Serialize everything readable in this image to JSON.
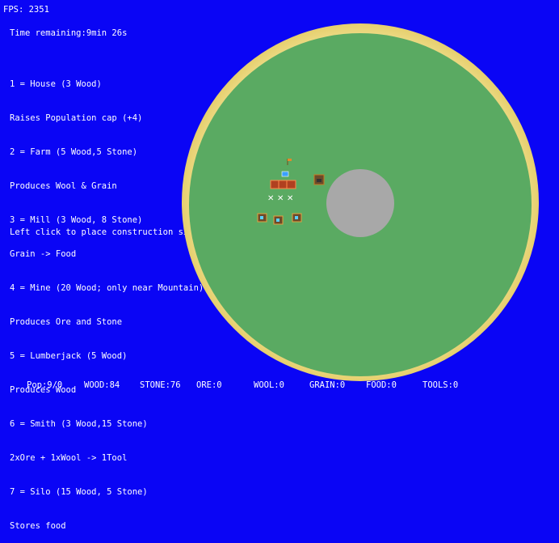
{
  "hud": {
    "fps": "FPS: 2351",
    "time_remaining": "Time remaining:9min 26s"
  },
  "build_menu": [
    "1 = House (3 Wood)",
    "Raises Population cap (+4)",
    "2 = Farm (5 Wood,5 Stone)",
    "Produces Wool & Grain",
    "3 = Mill (3 Wood, 8 Stone)",
    "Grain -> Food",
    "4 = Mine (20 Wood; only near Mountain)",
    "Produces Ore and Stone",
    "5 = Lumberjack (5 Wood)",
    "Produces Wood",
    "6 = Smith (3 Wood,15 Stone)",
    "2xOre + 1xWool -> 1Tool",
    "7 = Silo (15 Wood, 5 Stone)",
    "Stores food"
  ],
  "hint": "Left click to place construction site.",
  "resources": {
    "pop": "Pop:9/0",
    "wood": "WOOD:84",
    "stone": "STONE:76",
    "ore": "ORE:0",
    "wool": "WOOL:0",
    "grain": "GRAIN:0",
    "food": "FOOD:0",
    "tools": "TOOLS:0"
  },
  "colors": {
    "background": "#0a05f5",
    "sand": "#ecd77a",
    "grass": "#5aaa62",
    "mountain": "#a8a8a8",
    "text": "#ffffff"
  }
}
